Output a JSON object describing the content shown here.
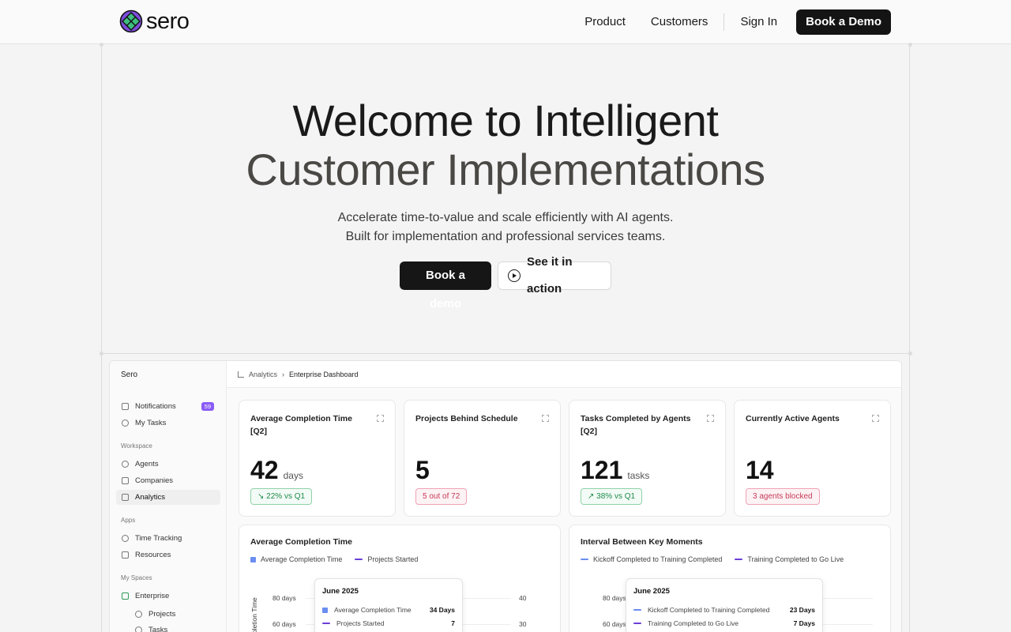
{
  "nav": {
    "brand": "sero",
    "links": [
      "Product",
      "Customers"
    ],
    "signin": "Sign In",
    "cta": "Book a Demo"
  },
  "hero": {
    "title_line1": "Welcome to Intelligent",
    "title_line2": "Customer Implementations",
    "sub_line1": "Accelerate time-to-value and scale efficiently with AI agents.",
    "sub_line2": "Built for implementation and professional services teams.",
    "primary_cta": "Book a demo",
    "secondary_cta": "See it in action"
  },
  "dashboard": {
    "brand": "Sero",
    "breadcrumb": [
      "Analytics",
      "Enterprise Dashboard"
    ],
    "sidebar": {
      "notifications": "Notifications",
      "notifications_count": "59",
      "my_tasks": "My Tasks",
      "workspace_head": "Workspace",
      "agents": "Agents",
      "companies": "Companies",
      "analytics": "Analytics",
      "apps_head": "Apps",
      "time_tracking": "Time Tracking",
      "resources": "Resources",
      "spaces_head": "My Spaces",
      "enterprise": "Enterprise",
      "projects": "Projects",
      "tasks": "Tasks"
    },
    "kpis": [
      {
        "title": "Average Completion Time [Q2]",
        "value": "42",
        "unit": "days",
        "tag": "↘ 22% vs Q1",
        "tag_color": "green"
      },
      {
        "title": "Projects Behind Schedule",
        "value": "5",
        "unit": "",
        "tag": "5 out of 72",
        "tag_color": "red"
      },
      {
        "title": "Tasks Completed by Agents [Q2]",
        "value": "121",
        "unit": "tasks",
        "tag": "↗ 38% vs Q1",
        "tag_color": "green"
      },
      {
        "title": "Currently Active Agents",
        "value": "14",
        "unit": "",
        "tag": "3 agents blocked",
        "tag_color": "red"
      }
    ],
    "chart1": {
      "title": "Average Completion Time",
      "legend": [
        "Average Completion Time",
        "Projects Started"
      ],
      "y_left": [
        "80 days",
        "60 days"
      ],
      "y_right": [
        "40",
        "30"
      ],
      "y_label": "Completion Time",
      "tooltip": {
        "month": "June 2025",
        "rows": [
          {
            "label": "Average Completion Time",
            "value": "34 Days"
          },
          {
            "label": "Projects Started",
            "value": "7"
          }
        ]
      }
    },
    "chart2": {
      "title": "Interval Between Key Moments",
      "legend": [
        "Kickoff Completed to Training Completed",
        "Training Completed to Go Live"
      ],
      "y_left": [
        "80 days",
        "60 days"
      ],
      "tooltip": {
        "month": "June 2025",
        "rows": [
          {
            "label": "Kickoff Completed to Training Completed",
            "value": "23 Days"
          },
          {
            "label": "Training Completed to Go Live",
            "value": "7 Days"
          }
        ]
      }
    },
    "colors": {
      "blue": "#6b8ef0",
      "purple": "#6a3fd8",
      "badge": "#8a5cf6"
    }
  }
}
